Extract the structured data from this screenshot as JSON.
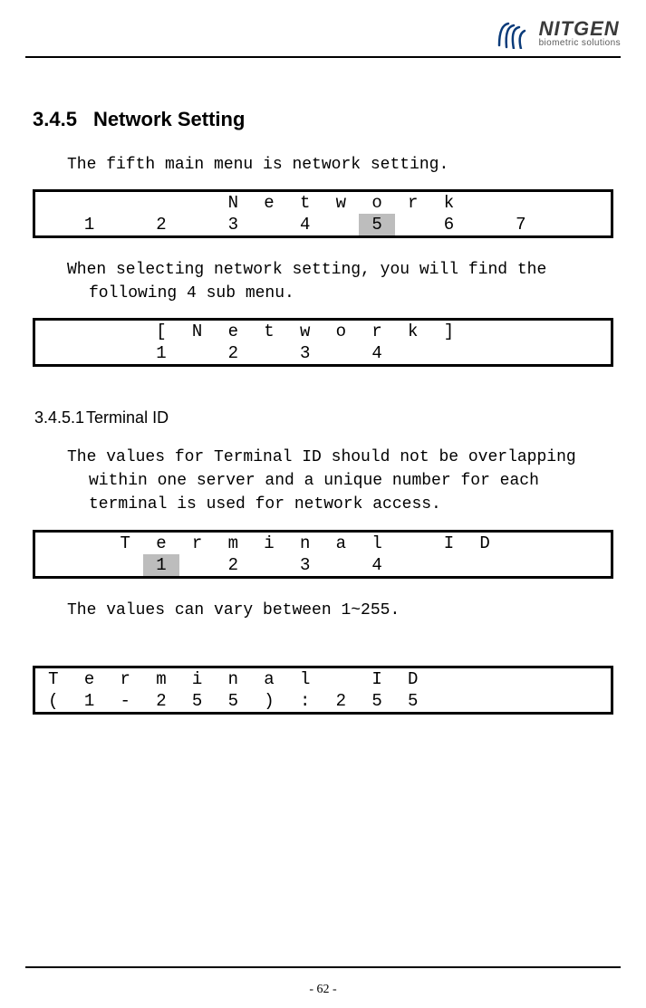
{
  "header": {
    "brand": "NITGEN",
    "tagline": "biometric solutions"
  },
  "section": {
    "number": "3.4.5",
    "title": "Network Setting"
  },
  "intro": "The fifth main menu is network setting.",
  "lcd1": {
    "row1": [
      "",
      "",
      "",
      "",
      "",
      "N",
      "e",
      "t",
      "w",
      "o",
      "r",
      "k",
      "",
      "",
      "",
      ""
    ],
    "row2": [
      "",
      "1",
      "",
      "2",
      "",
      "3",
      "",
      "4",
      "",
      "5",
      "",
      "6",
      "",
      "7",
      "",
      ""
    ],
    "highlight_col": 9
  },
  "para2": "When selecting network setting, you will find the following 4 sub menu.",
  "lcd2": {
    "row1": [
      "",
      "",
      "",
      "[",
      "N",
      "e",
      "t",
      "w",
      "o",
      "r",
      "k",
      "]",
      "",
      "",
      "",
      ""
    ],
    "row2": [
      "",
      "",
      "",
      "1",
      "",
      "2",
      "",
      "3",
      "",
      "4",
      "",
      "",
      "",
      "",
      "",
      ""
    ]
  },
  "subsection": {
    "number": "3.4.5.1",
    "title": "Terminal ID"
  },
  "para3": "The values for Terminal ID should not be overlapping within one server and a unique number for each terminal is used for network access.",
  "lcd3": {
    "row1": [
      "",
      "",
      "T",
      "e",
      "r",
      "m",
      "i",
      "n",
      "a",
      "l",
      "",
      "I",
      "D",
      "",
      "",
      ""
    ],
    "row2": [
      "",
      "",
      "",
      "1",
      "",
      "2",
      "",
      "3",
      "",
      "4",
      "",
      "",
      "",
      "",
      "",
      ""
    ],
    "highlight_col": 3
  },
  "para4": "The values can vary between 1~255.",
  "lcd4": {
    "row1": [
      "T",
      "e",
      "r",
      "m",
      "i",
      "n",
      "a",
      "l",
      "",
      "I",
      "D",
      "",
      "",
      "",
      "",
      ""
    ],
    "row2": [
      "(",
      "1",
      "-",
      "2",
      "5",
      "5",
      ")",
      ":",
      "2",
      "5",
      "5",
      "",
      "",
      "",
      "",
      ""
    ]
  },
  "page_number": "- 62 -"
}
